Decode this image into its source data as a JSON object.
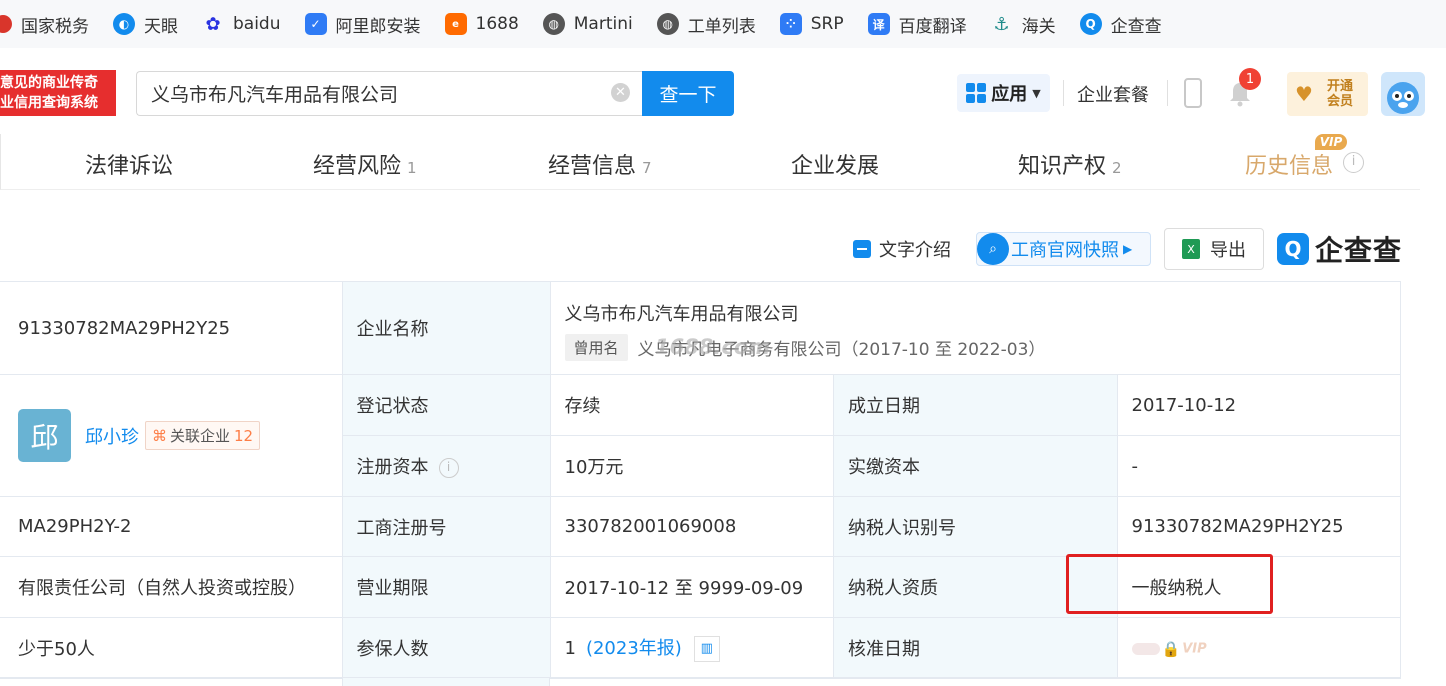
{
  "bookmarks": [
    {
      "label": "国家税务",
      "icon": "tax-emblem-icon",
      "color": "#d9352b"
    },
    {
      "label": "天眼",
      "icon": "tianyan-icon",
      "color": "#128bed"
    },
    {
      "label": "baidu",
      "icon": "baidu-paw-icon",
      "color": "#2932e1"
    },
    {
      "label": "阿里郎安装",
      "icon": "shield-icon",
      "color": "#2f7bf5"
    },
    {
      "label": "1688",
      "icon": "1688-icon",
      "color": "#ff6a00"
    },
    {
      "label": "Martini",
      "icon": "globe-icon",
      "color": "#555555"
    },
    {
      "label": "工单列表",
      "icon": "globe-icon",
      "color": "#555555"
    },
    {
      "label": "SRP",
      "icon": "dots-icon",
      "color": "#2f7bf5"
    },
    {
      "label": "百度翻译",
      "icon": "translate-icon",
      "color": "#2f7bf5"
    },
    {
      "label": "海关",
      "icon": "customs-icon",
      "color": "#1d8a8a"
    },
    {
      "label": "企查查",
      "icon": "qcc-icon",
      "color": "#128bed"
    }
  ],
  "header": {
    "slogan_line1": "意见的商业传奇",
    "slogan_line2": "业信用查询系统",
    "search_value": "义乌市布凡汽车用品有限公司",
    "search_button": "查一下",
    "apps_label": "应用",
    "package_label": "企业套餐",
    "bell_count": "1",
    "vip_open_line1": "开通",
    "vip_open_line2": "会员"
  },
  "tabs": [
    {
      "label": "法律诉讼",
      "count": ""
    },
    {
      "label": "经营风险",
      "count": "1"
    },
    {
      "label": "经营信息",
      "count": "7"
    },
    {
      "label": "企业发展",
      "count": ""
    },
    {
      "label": "知识产权",
      "count": "2"
    },
    {
      "label": "历史信息",
      "count": ""
    }
  ],
  "vip_tag": "VIP",
  "toolbar": {
    "text_intro": "文字介绍",
    "gs_snapshot": "工商官网快照",
    "export": "导出",
    "logo_text": "企查查"
  },
  "table": {
    "credit_code": "91330782MA29PH2Y25",
    "company_name_label": "企业名称",
    "company_name": "义乌市布凡汽车用品有限公司",
    "former_name_tag": "曾用名",
    "former_name": "义乌市凡电子商务有限公司（2017-10 至 2022-03）",
    "watermark": "1688.com",
    "person_initial": "邱",
    "person_name": "邱小珍",
    "related_label": "关联企业",
    "related_count": "12",
    "reg_status_label": "登记状态",
    "reg_status": "存续",
    "est_date_label": "成立日期",
    "est_date": "2017-10-12",
    "reg_capital_label": "注册资本",
    "reg_capital": "10万元",
    "paid_capital_label": "实缴资本",
    "paid_capital": "-",
    "org_code": "MA29PH2Y-2",
    "reg_no_label": "工商注册号",
    "reg_no": "330782001069008",
    "taxpayer_id_label": "纳税人识别号",
    "taxpayer_id": "91330782MA29PH2Y25",
    "company_type": "有限责任公司（自然人投资或控股）",
    "term_label": "营业期限",
    "term": "2017-10-12 至 9999-09-09",
    "taxpayer_qual_label": "纳税人资质",
    "taxpayer_qual": "一般纳税人",
    "staff_size": "少于50人",
    "insured_label": "参保人数",
    "insured_count": "1",
    "insured_report": "(2023年报)",
    "approval_date_label": "核准日期",
    "vip_blur_text": "VIP"
  },
  "colors": {
    "accent": "#128bed",
    "label_bg": "#f2f9fc",
    "highlight_box": "#e02020"
  }
}
